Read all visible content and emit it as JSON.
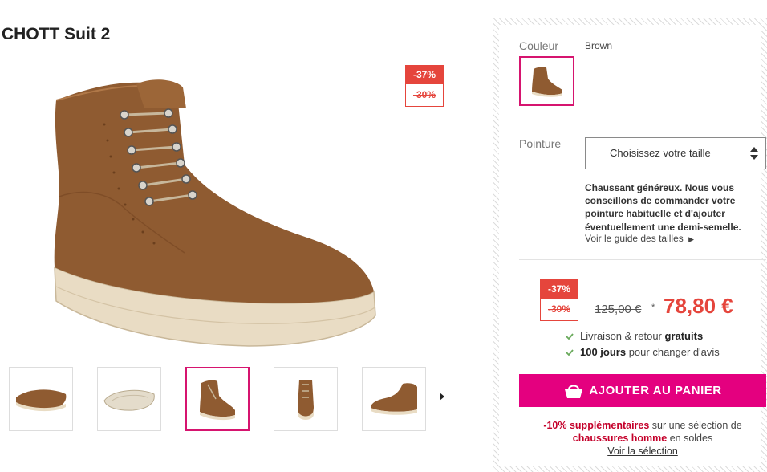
{
  "product": {
    "brand": "CHOTT",
    "model": "Suit 2"
  },
  "badges": {
    "discount_main": "-37%",
    "discount_secondary": "-30%"
  },
  "gallery": {
    "thumbnails": [
      {
        "icon": "shoe-sole-side-icon",
        "active": false
      },
      {
        "icon": "shoe-sole-bottom-icon",
        "active": false
      },
      {
        "icon": "shoe-three-quarter-icon",
        "active": true
      },
      {
        "icon": "shoe-front-icon",
        "active": false
      },
      {
        "icon": "shoe-side-icon",
        "active": false
      }
    ],
    "next_icon": "chevron-right-icon"
  },
  "options": {
    "colour_label": "Couleur",
    "colour_value": "Brown",
    "size_label": "Pointure",
    "size_placeholder": "Choisissez votre taille",
    "fit_note": "Chaussant généreux. Nous vous conseillons de commander votre pointure habituelle et d'ajouter éventuellement une demi-semelle.",
    "size_guide_link": "Voir le guide des tailles"
  },
  "pricing": {
    "old_price": "125,00 €",
    "star": "*",
    "new_price": "78,80 €"
  },
  "features": [
    {
      "text": "Livraison & retour ",
      "bold": "gratuits"
    },
    {
      "bold": "100 jours",
      "text": " pour changer d'avis"
    }
  ],
  "cta": {
    "label": "AJOUTER AU PANIER",
    "icon": "shopping-bag-icon"
  },
  "promo": {
    "highlight1": "-10% supplémentaires",
    "text1": " sur une sélection de",
    "highlight2": "chaussures homme",
    "text2": " en soldes",
    "link": "Voir la sélection"
  },
  "colors": {
    "accent_pink": "#e4007f",
    "selected_border": "#d6146f",
    "discount_red": "#e5453c",
    "check_green": "#6aaa5c",
    "suede_brown": "#8f5b31"
  }
}
